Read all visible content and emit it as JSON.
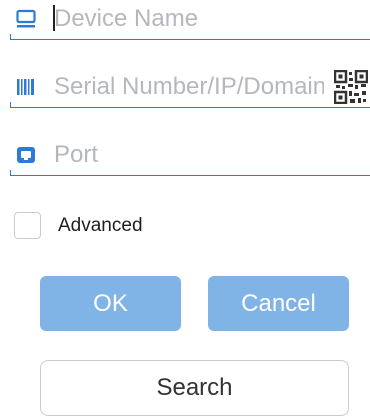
{
  "form": {
    "device_name": {
      "placeholder": "Device Name",
      "value": ""
    },
    "serial": {
      "placeholder": "Serial Number/IP/Domain",
      "value": ""
    },
    "port": {
      "placeholder": "Port",
      "value": ""
    },
    "advanced_label": "Advanced",
    "advanced_checked": false
  },
  "buttons": {
    "ok_label": "OK",
    "cancel_label": "Cancel",
    "search_label": "Search"
  },
  "icons": {
    "device": "monitor-icon",
    "serial": "barcode-icon",
    "port": "port-icon",
    "scan": "qr-code-icon"
  },
  "colors": {
    "accent": "#2f7bd4",
    "button": "#80b3e6",
    "placeholder": "#b4b8be"
  }
}
